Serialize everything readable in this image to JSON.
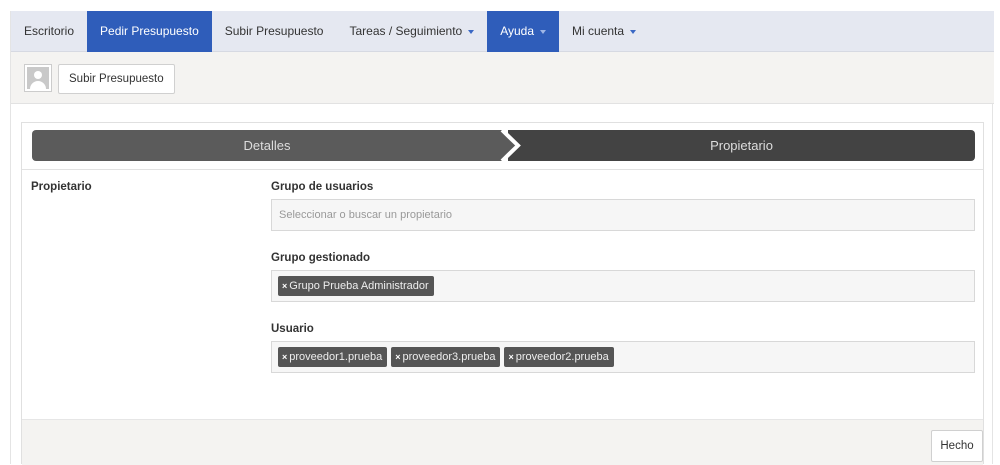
{
  "nav": {
    "items": [
      {
        "label": "Escritorio",
        "active": false,
        "dropdown": false
      },
      {
        "label": "Pedir Presupuesto",
        "active": true,
        "dropdown": false
      },
      {
        "label": "Subir Presupuesto",
        "active": false,
        "dropdown": false
      },
      {
        "label": "Tareas / Seguimiento",
        "active": false,
        "dropdown": true
      },
      {
        "label": "Ayuda",
        "active": true,
        "dropdown": true
      },
      {
        "label": "Mi cuenta",
        "active": false,
        "dropdown": true
      }
    ]
  },
  "subbar": {
    "button_label": "Subir Presupuesto"
  },
  "wizard": {
    "steps": [
      {
        "label": "Detalles"
      },
      {
        "label": "Propietario"
      }
    ]
  },
  "form": {
    "section_label": "Propietario",
    "user_group": {
      "label": "Grupo de usuarios",
      "placeholder": "Seleccionar o buscar un propietario"
    },
    "managed_group": {
      "label": "Grupo gestionado",
      "tags": [
        "Grupo Prueba Administrador"
      ]
    },
    "user": {
      "label": "Usuario",
      "tags": [
        "proveedor1.prueba",
        "proveedor3.prueba",
        "proveedor2.prueba"
      ]
    },
    "tag_remove_symbol": "×"
  },
  "footer": {
    "done_label": "Hecho"
  },
  "colors": {
    "nav_bg": "#e5e8f1",
    "nav_active": "#2f5dba",
    "step_done": "#5b5b5b",
    "step_current": "#434343"
  }
}
